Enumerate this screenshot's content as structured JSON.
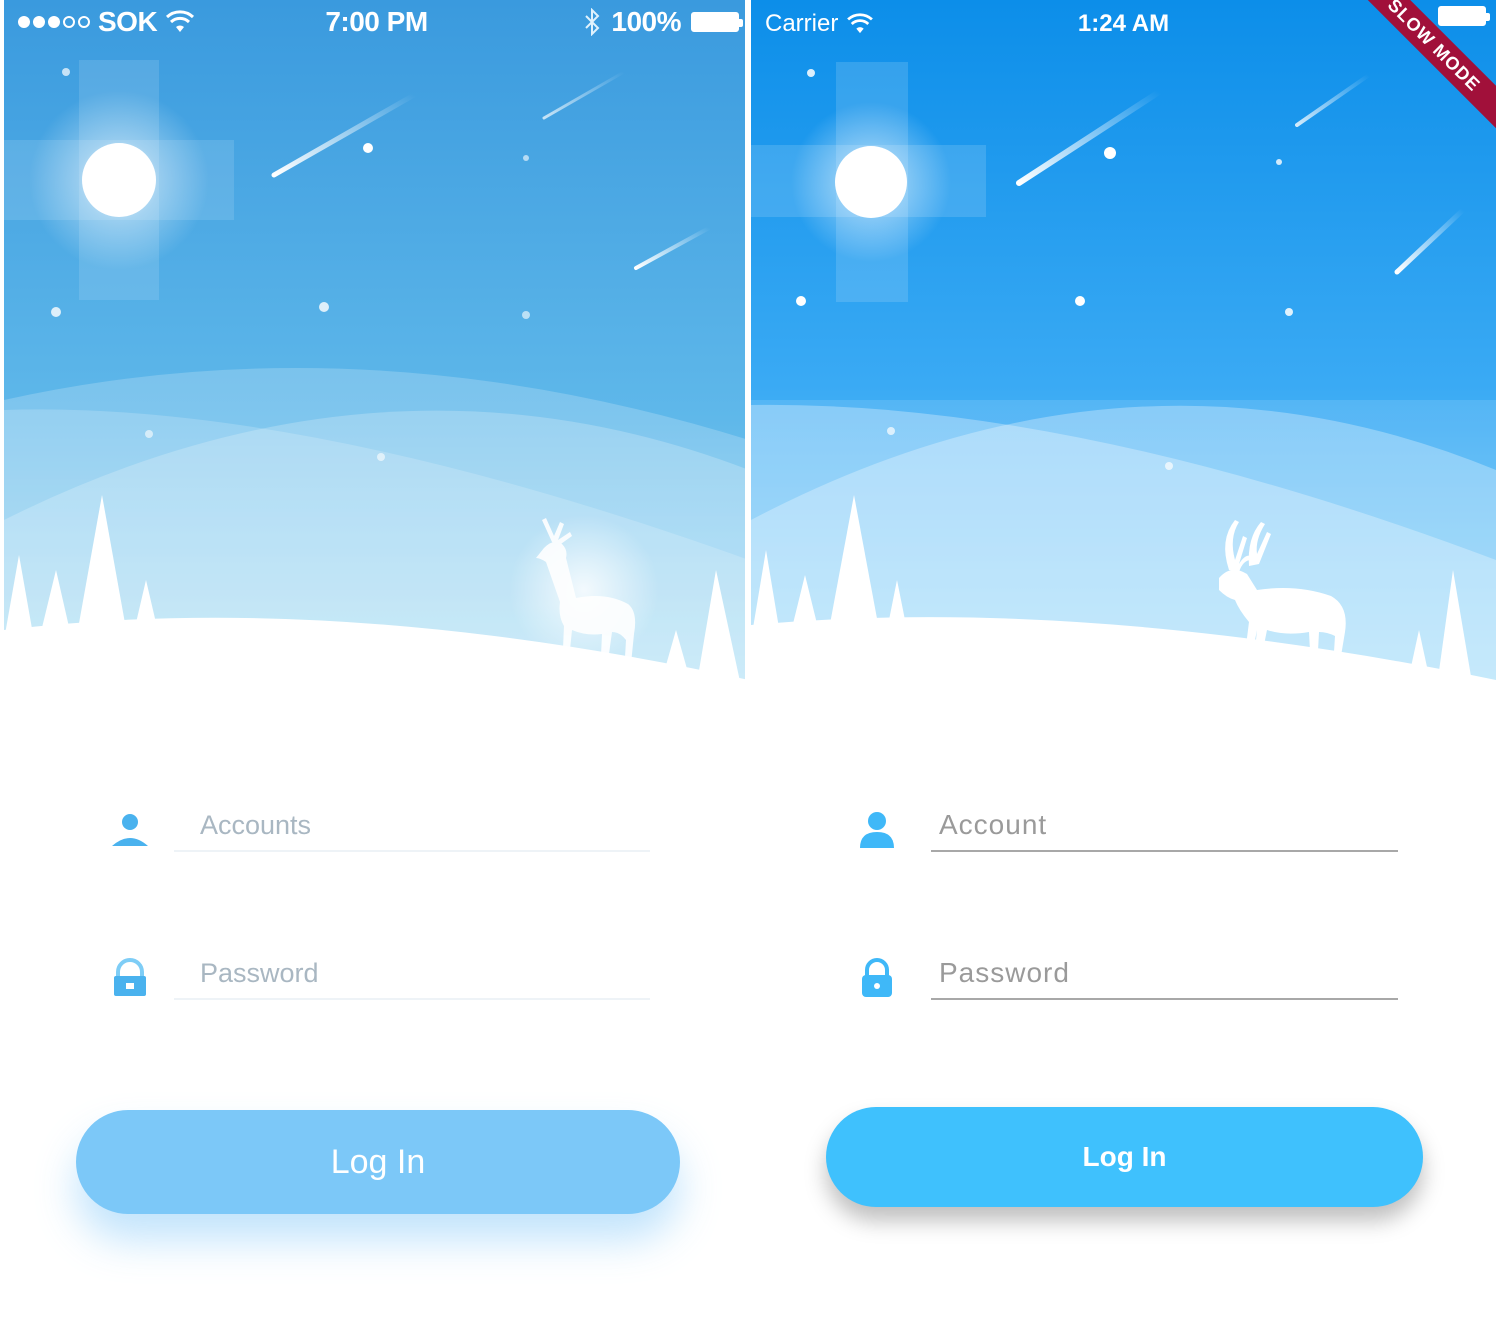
{
  "left_phone": {
    "status": {
      "carrier": "SOK",
      "time": "7:00 PM",
      "battery": "100%"
    },
    "form": {
      "account_placeholder": "Accounts",
      "password_placeholder": "Password"
    },
    "login_label": "Log In",
    "colors": {
      "sky_top": "#3a9fdf",
      "sky_bottom": "#8fd2f4",
      "button": "#7cc8f8",
      "icon": "#4ab2ee"
    }
  },
  "right_phone": {
    "status": {
      "carrier": "Carrier",
      "time": "1:24 AM"
    },
    "debug_banner": "SLOW MODE",
    "form": {
      "account_placeholder": "Account",
      "password_placeholder": "Password"
    },
    "login_label": "Log In",
    "colors": {
      "sky_top": "#0f92ea",
      "sky_bottom": "#6ac8f8",
      "button": "#3fc1fd",
      "icon": "#3fb8f8"
    }
  }
}
